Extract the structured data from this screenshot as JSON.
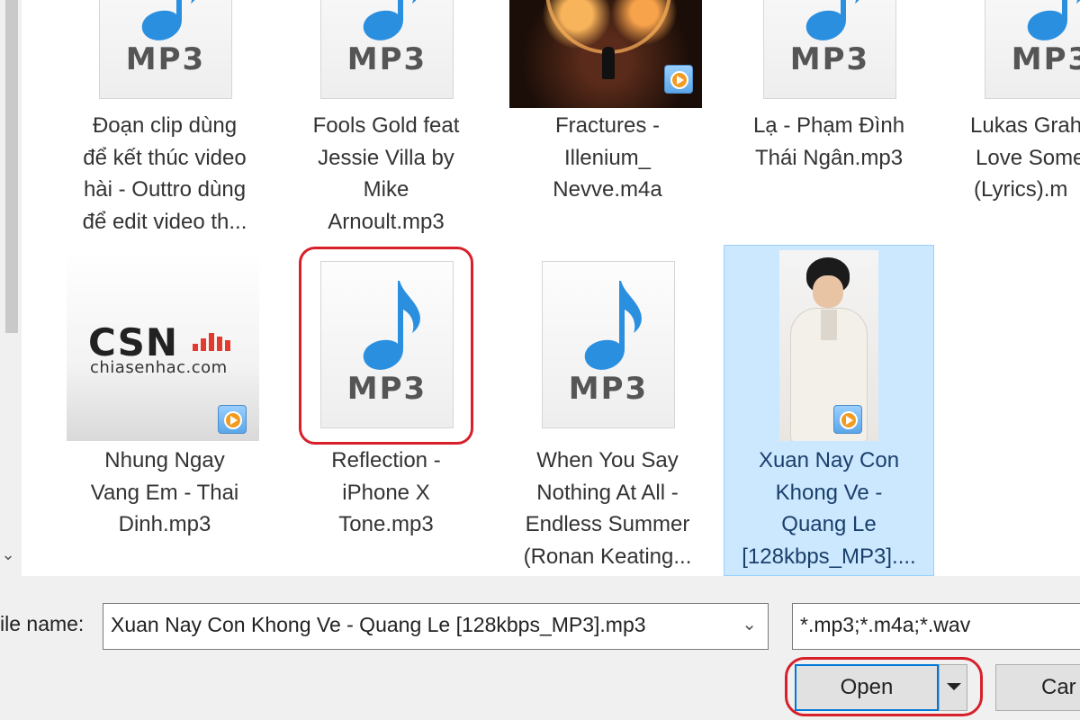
{
  "files": [
    {
      "name": "Đoạn clip dùng để kết thúc video hài - Outtro dùng để edit video th...",
      "lines": [
        "Đoạn clip dùng",
        "để kết thúc video",
        "hài - Outtro dùng",
        "để edit video th..."
      ],
      "thumb": "mp3-doc-icon",
      "selected": false
    },
    {
      "name": "Fools Gold feat Jessie Villa by Mike Arnoult.mp3",
      "lines": [
        "Fools Gold feat",
        "Jessie Villa by",
        "Mike",
        "Arnoult.mp3"
      ],
      "thumb": "mp3-doc-icon",
      "selected": false
    },
    {
      "name": "Fractures - Illenium_ Nevve.m4a",
      "lines": [
        "Fractures -",
        "Illenium_",
        "Nevve.m4a"
      ],
      "thumb": "album-art-with-play-badge",
      "selected": false
    },
    {
      "name": "Lạ - Phạm Đình Thái Ngân.mp3",
      "lines": [
        "Lạ - Phạm Đình",
        "Thái Ngân.mp3"
      ],
      "thumb": "mp3-doc-icon",
      "selected": false
    },
    {
      "name": "Lukas Grah... Love Some... (Lyrics).m...",
      "lines": [
        "Lukas Grah",
        "Love Some",
        "(Lyrics).m"
      ],
      "thumb": "mp3-doc-icon",
      "selected": false
    },
    {
      "name": "Nhung Ngay Vang Em - Thai Dinh.mp3",
      "lines": [
        "Nhung Ngay",
        "Vang Em - Thai",
        "Dinh.mp3"
      ],
      "thumb": "csn-album-art-with-play-badge",
      "csn_logo": "CSN",
      "csn_domain": "chiasenhac.com",
      "selected": false
    },
    {
      "name": "Reflection - iPhone X Tone.mp3",
      "lines": [
        "Reflection -",
        "iPhone X",
        "Tone.mp3"
      ],
      "thumb": "mp3-doc-icon",
      "selected": false,
      "highlighted": true
    },
    {
      "name": "When You Say Nothing At All - Endless Summer (Ronan Keating...",
      "lines": [
        "When You Say",
        "Nothing At All -",
        "Endless Summer",
        "(Ronan Keating..."
      ],
      "thumb": "mp3-doc-icon",
      "selected": false
    },
    {
      "name": "Xuan Nay Con Khong Ve - Quang Le [128kbps_MP3]....",
      "lines": [
        "Xuan Nay Con",
        "Khong Ve -",
        "Quang Le",
        "[128kbps_MP3]...."
      ],
      "thumb": "portrait-album-art-with-play-badge",
      "selected": true
    }
  ],
  "mp3_icon_text": "MP3",
  "footer": {
    "file_name_label": "ile name:",
    "file_name_value": "Xuan Nay Con Khong Ve - Quang Le [128kbps_MP3].mp3",
    "filter_value": "*.mp3;*.m4a;*.wav",
    "open_label": "Open",
    "cancel_label": "Car"
  },
  "colors": {
    "selection_bg": "#cce8ff",
    "highlight_ring": "#d7202a",
    "music_note": "#2b8fe0"
  }
}
